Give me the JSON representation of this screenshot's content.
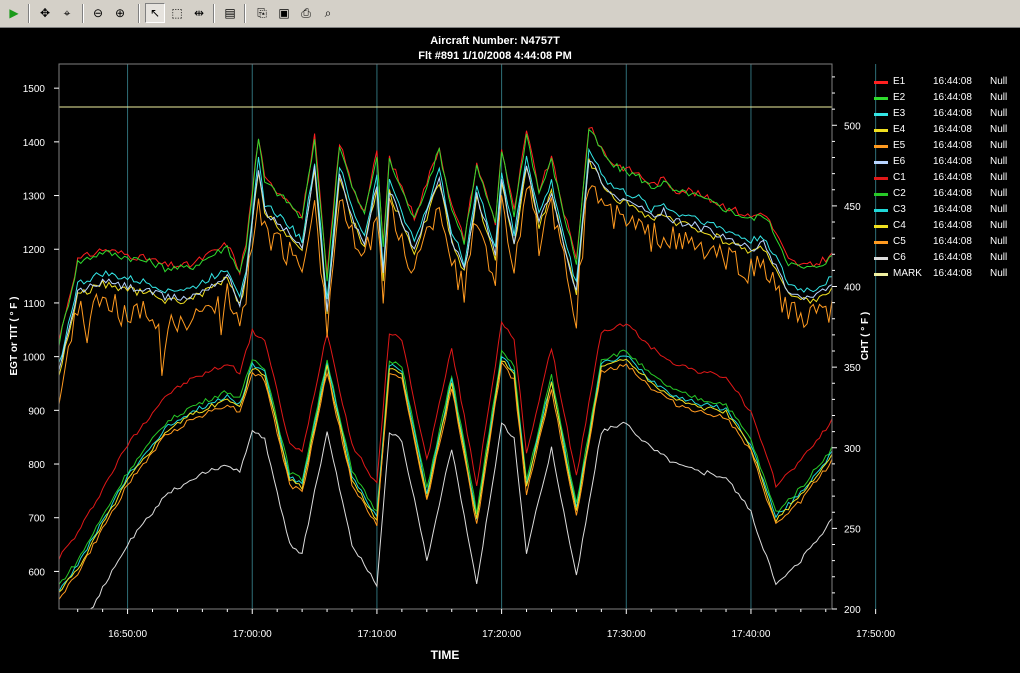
{
  "toolbar": {
    "buttons": [
      {
        "name": "play-icon",
        "glyph": "▶"
      },
      {
        "name": "pan-icon",
        "glyph": "✥"
      },
      {
        "name": "zoom-select-icon",
        "glyph": "⌖"
      },
      {
        "name": "zoom-out-icon",
        "glyph": "⊖"
      },
      {
        "name": "zoom-in-icon",
        "glyph": "⊕"
      },
      {
        "name": "pointer-icon",
        "glyph": "↖"
      },
      {
        "name": "select-rect-icon",
        "glyph": "⬚"
      },
      {
        "name": "fit-range-icon",
        "glyph": "⇹"
      },
      {
        "name": "properties-icon",
        "glyph": "▤"
      },
      {
        "name": "copy-icon",
        "glyph": "⎘"
      },
      {
        "name": "save-icon",
        "glyph": "▣"
      },
      {
        "name": "print-icon",
        "glyph": "⎙"
      },
      {
        "name": "print-preview-icon",
        "glyph": "⌕"
      }
    ]
  },
  "chart_data": {
    "type": "line",
    "title": "Aircraft Number: N4757T",
    "subtitle": "Flt #891 1/10/2008 4:44:08 PM",
    "xlabel": "TIME",
    "ylabel_left": "EGT or TIT ( ° F )",
    "ylabel_right": "CHT ( ° F )",
    "x_ticks": [
      "16:50:00",
      "17:00:00",
      "17:10:00",
      "17:20:00",
      "17:30:00",
      "17:40:00",
      "17:50:00"
    ],
    "x_range_minutes": [
      -5.5,
      56.5
    ],
    "y_left_ticks": [
      600,
      700,
      800,
      900,
      1000,
      1100,
      1200,
      1300,
      1400,
      1500
    ],
    "y_left_range": [
      530,
      1545
    ],
    "y_right_ticks": [
      200,
      250,
      300,
      350,
      400,
      450,
      500
    ],
    "y_right_range": [
      200,
      538
    ],
    "grid": "vertical lines at time ticks",
    "reference_line": {
      "axis": "left",
      "value": 1465
    },
    "egt_series_names": [
      "E1",
      "E2",
      "E3",
      "E4",
      "E5",
      "E6"
    ],
    "cht_series_names": [
      "C1",
      "C2",
      "C3",
      "C4",
      "C5",
      "C6"
    ],
    "egt_waveform": {
      "x": [
        -5.5,
        -4,
        -2,
        0,
        2,
        3,
        5,
        8,
        9,
        9.5,
        10.5,
        11,
        13,
        14,
        15,
        16,
        17,
        18,
        19,
        20,
        20.5,
        21,
        23,
        25,
        26,
        27,
        28,
        29.5,
        30,
        31,
        32,
        33,
        34,
        35,
        36,
        37,
        38,
        38.5,
        39,
        40,
        41,
        42,
        43,
        44,
        45,
        46,
        47,
        48,
        49,
        50,
        51,
        52,
        53,
        54,
        55,
        56.5
      ],
      "y": [
        1000,
        1150,
        1170,
        1160,
        1150,
        1140,
        1140,
        1180,
        1130,
        1180,
        1380,
        1300,
        1260,
        1230,
        1380,
        1120,
        1370,
        1290,
        1240,
        1350,
        1180,
        1340,
        1230,
        1360,
        1250,
        1190,
        1330,
        1220,
        1360,
        1240,
        1390,
        1280,
        1340,
        1240,
        1150,
        1400,
        1360,
        1340,
        1330,
        1320,
        1310,
        1290,
        1300,
        1280,
        1280,
        1270,
        1260,
        1250,
        1240,
        1230,
        1240,
        1200,
        1150,
        1140,
        1140,
        1160
      ]
    },
    "cht_waveform": {
      "x": [
        -5.5,
        -4,
        0,
        2,
        3,
        5,
        8,
        9,
        10,
        11,
        13,
        14,
        16,
        18,
        20,
        21,
        22,
        24,
        26,
        28,
        30,
        31,
        32,
        34,
        36,
        38,
        40,
        42,
        44,
        46,
        48,
        50,
        52,
        54,
        56.5
      ],
      "y": [
        210,
        225,
        280,
        300,
        310,
        320,
        330,
        325,
        350,
        345,
        280,
        275,
        350,
        280,
        255,
        350,
        345,
        270,
        340,
        255,
        355,
        345,
        275,
        340,
        260,
        350,
        355,
        340,
        330,
        325,
        322,
        300,
        255,
        270,
        295
      ]
    },
    "egt_offsets": [
      30,
      25,
      -15,
      -35,
      -70,
      -30
    ],
    "cht_offsets": [
      22,
      5,
      2,
      0,
      -3,
      -40
    ],
    "legend": [
      {
        "name": "E1",
        "time": "16:44:08",
        "value": "Null",
        "color": "#ff2020"
      },
      {
        "name": "E2",
        "time": "16:44:08",
        "value": "Null",
        "color": "#2edc2e"
      },
      {
        "name": "E3",
        "time": "16:44:08",
        "value": "Null",
        "color": "#33e6e6"
      },
      {
        "name": "E4",
        "time": "16:44:08",
        "value": "Null",
        "color": "#f0e020"
      },
      {
        "name": "E5",
        "time": "16:44:08",
        "value": "Null",
        "color": "#ff9a20"
      },
      {
        "name": "E6",
        "time": "16:44:08",
        "value": "Null",
        "color": "#b8d4ff"
      },
      {
        "name": "C1",
        "time": "16:44:08",
        "value": "Null",
        "color": "#e01818"
      },
      {
        "name": "C2",
        "time": "16:44:08",
        "value": "Null",
        "color": "#27c927"
      },
      {
        "name": "C3",
        "time": "16:44:08",
        "value": "Null",
        "color": "#20d8d8"
      },
      {
        "name": "C4",
        "time": "16:44:08",
        "value": "Null",
        "color": "#f0e020"
      },
      {
        "name": "C5",
        "time": "16:44:08",
        "value": "Null",
        "color": "#ff9a20"
      },
      {
        "name": "C6",
        "time": "16:44:08",
        "value": "Null",
        "color": "#dcdcdc"
      },
      {
        "name": "MARK",
        "time": "16:44:08",
        "value": "Null",
        "color": "#f0f0a0"
      }
    ],
    "colors": {
      "background": "#000000",
      "plot_border": "#808080",
      "grid": "#2f6f78",
      "text": "#ffffff",
      "reference_line": "#f0f0a0"
    }
  }
}
